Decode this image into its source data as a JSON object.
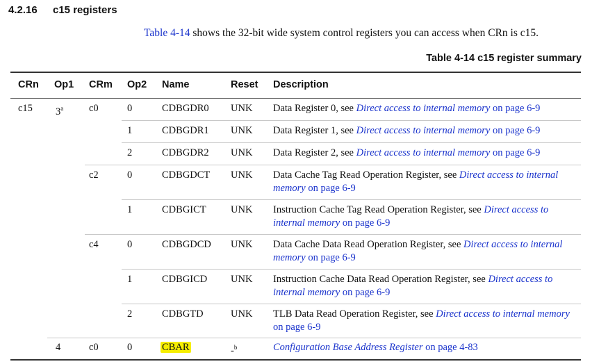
{
  "section": {
    "number": "4.2.16",
    "title": "c15 registers"
  },
  "intro": {
    "link": "Table 4-14",
    "text": " shows the 32-bit wide system control registers you can access when CRn is c15."
  },
  "caption": "Table 4-14 c15 register summary",
  "columns": [
    "CRn",
    "Op1",
    "CRm",
    "Op2",
    "Name",
    "Reset",
    "Description"
  ],
  "rows": [
    {
      "crn": "c15",
      "op1": "3",
      "op1_note": "a",
      "crm": "c0",
      "op2": "0",
      "name": "CDBGDR0",
      "reset": "UNK",
      "desc_text": "Data Register 0, see ",
      "desc_link": "Direct access to internal memory",
      "desc_page": " on page 6-9"
    },
    {
      "crn": "",
      "op1": "",
      "op1_note": "",
      "crm": "",
      "op2": "1",
      "name": "CDBGDR1",
      "reset": "UNK",
      "desc_text": "Data Register 1, see ",
      "desc_link": "Direct access to internal memory",
      "desc_page": " on page 6-9"
    },
    {
      "crn": "",
      "op1": "",
      "op1_note": "",
      "crm": "",
      "op2": "2",
      "name": "CDBGDR2",
      "reset": "UNK",
      "desc_text": "Data Register 2, see ",
      "desc_link": "Direct access to internal memory",
      "desc_page": " on page 6-9"
    },
    {
      "crn": "",
      "op1": "",
      "op1_note": "",
      "crm": "c2",
      "op2": "0",
      "name": "CDBGDCT",
      "reset": "UNK",
      "desc_text": "Data Cache Tag Read Operation Register, see ",
      "desc_link": "Direct access to internal memory",
      "desc_page": " on page 6-9"
    },
    {
      "crn": "",
      "op1": "",
      "op1_note": "",
      "crm": "",
      "op2": "1",
      "name": "CDBGICT",
      "reset": "UNK",
      "desc_text": "Instruction Cache Tag Read Operation Register, see ",
      "desc_link": "Direct access to internal memory",
      "desc_page": " on page 6-9"
    },
    {
      "crn": "",
      "op1": "",
      "op1_note": "",
      "crm": "c4",
      "op2": "0",
      "name": "CDBGDCD",
      "reset": "UNK",
      "desc_text": "Data Cache Data Read Operation Register, see ",
      "desc_link": "Direct access to internal memory",
      "desc_page": " on page 6-9"
    },
    {
      "crn": "",
      "op1": "",
      "op1_note": "",
      "crm": "",
      "op2": "1",
      "name": "CDBGICD",
      "reset": "UNK",
      "desc_text": "Instruction Cache Data Read Operation Register, see ",
      "desc_link": "Direct access to internal memory",
      "desc_page": " on page 6-9"
    },
    {
      "crn": "",
      "op1": "",
      "op1_note": "",
      "crm": "",
      "op2": "2",
      "name": "CDBGTD",
      "reset": "UNK",
      "desc_text": "TLB Data Read Operation Register, see ",
      "desc_link": "Direct access to internal memory",
      "desc_page": " on page 6-9"
    },
    {
      "crn": "",
      "op1": "4",
      "op1_note": "",
      "crm": "c0",
      "op2": "0",
      "name": "CBAR",
      "reset": "-",
      "reset_note": "b",
      "desc_text": "",
      "desc_link": "Configuration Base Address Register",
      "desc_page": " on page 4-83"
    }
  ],
  "highlight_color": "#f6ee00",
  "link_color": "#1a33cc"
}
